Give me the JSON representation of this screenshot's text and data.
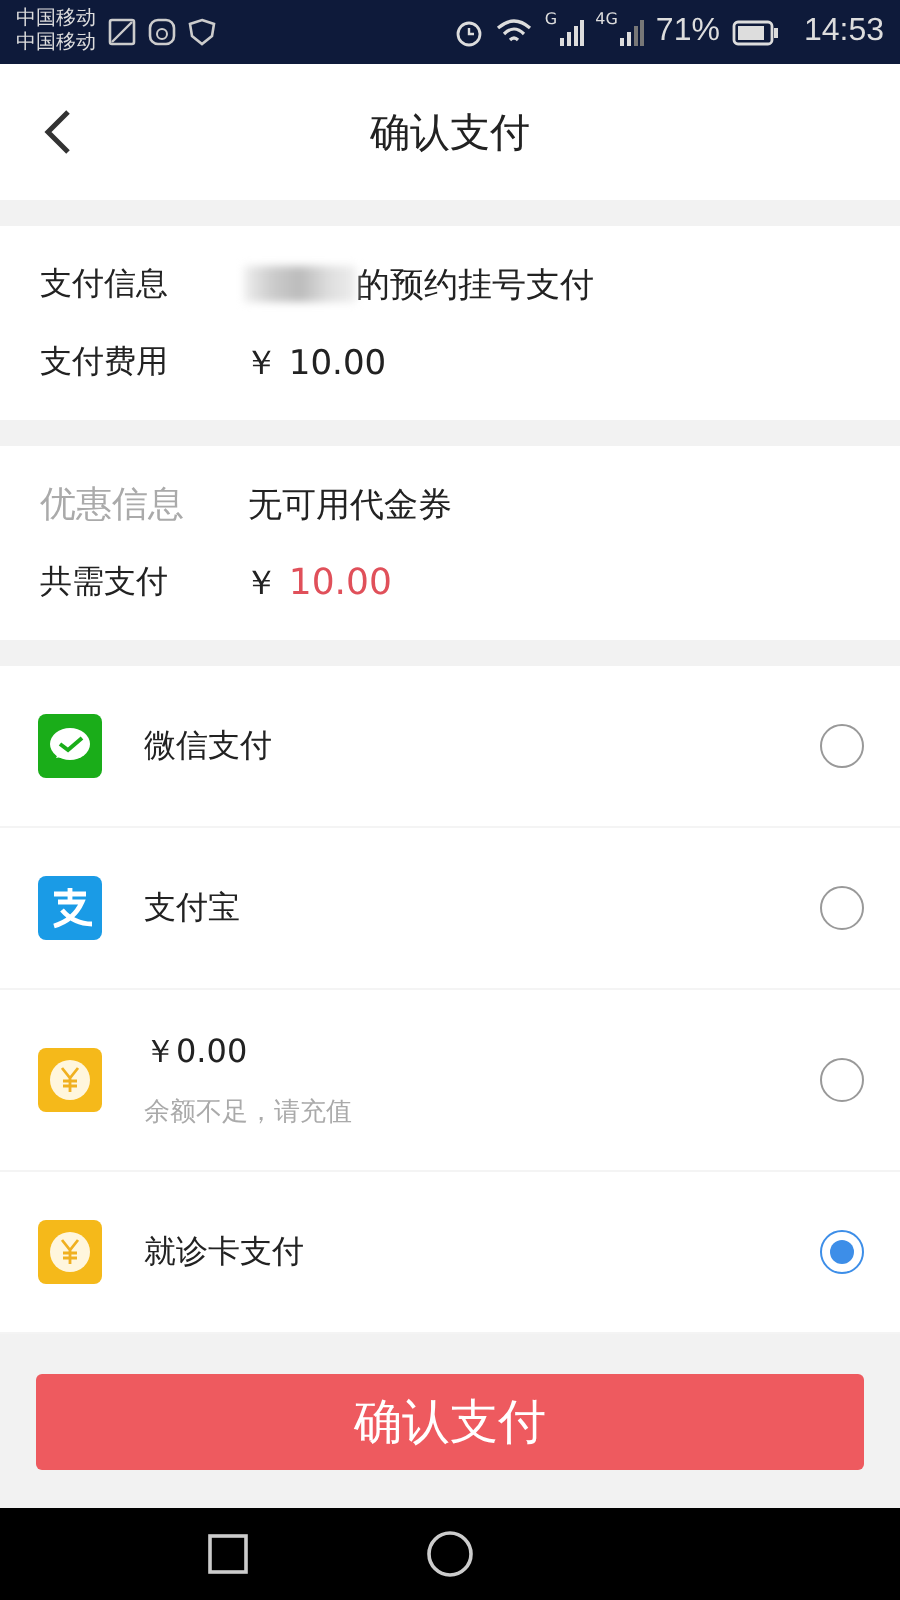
{
  "status_bar": {
    "carriers": [
      "中国移动",
      "中国移动"
    ],
    "network_labels": [
      "G",
      "4G"
    ],
    "battery": "71%",
    "time": "14:53"
  },
  "header": {
    "title": "确认支付"
  },
  "payment_info": [
    {
      "label": "支付信息",
      "value": "的预约挂号支付",
      "redacted": true
    },
    {
      "label": "支付费用",
      "value": "￥ 10.00",
      "redacted": false
    }
  ],
  "discount": {
    "label": "优惠信息",
    "value": "无可用代金券"
  },
  "total": {
    "label": "共需支付",
    "currency": "￥",
    "amount": "10.00"
  },
  "payment_methods": [
    {
      "kind": "wechat",
      "title": "微信支付",
      "selected": false
    },
    {
      "kind": "alipay",
      "title": "支付宝",
      "selected": false
    },
    {
      "kind": "balance",
      "title": "￥0.00",
      "note": "余额不足，请充值",
      "selected": false
    },
    {
      "kind": "card",
      "title": "就诊卡支付",
      "selected": true
    }
  ],
  "confirm_button": "确认支付"
}
